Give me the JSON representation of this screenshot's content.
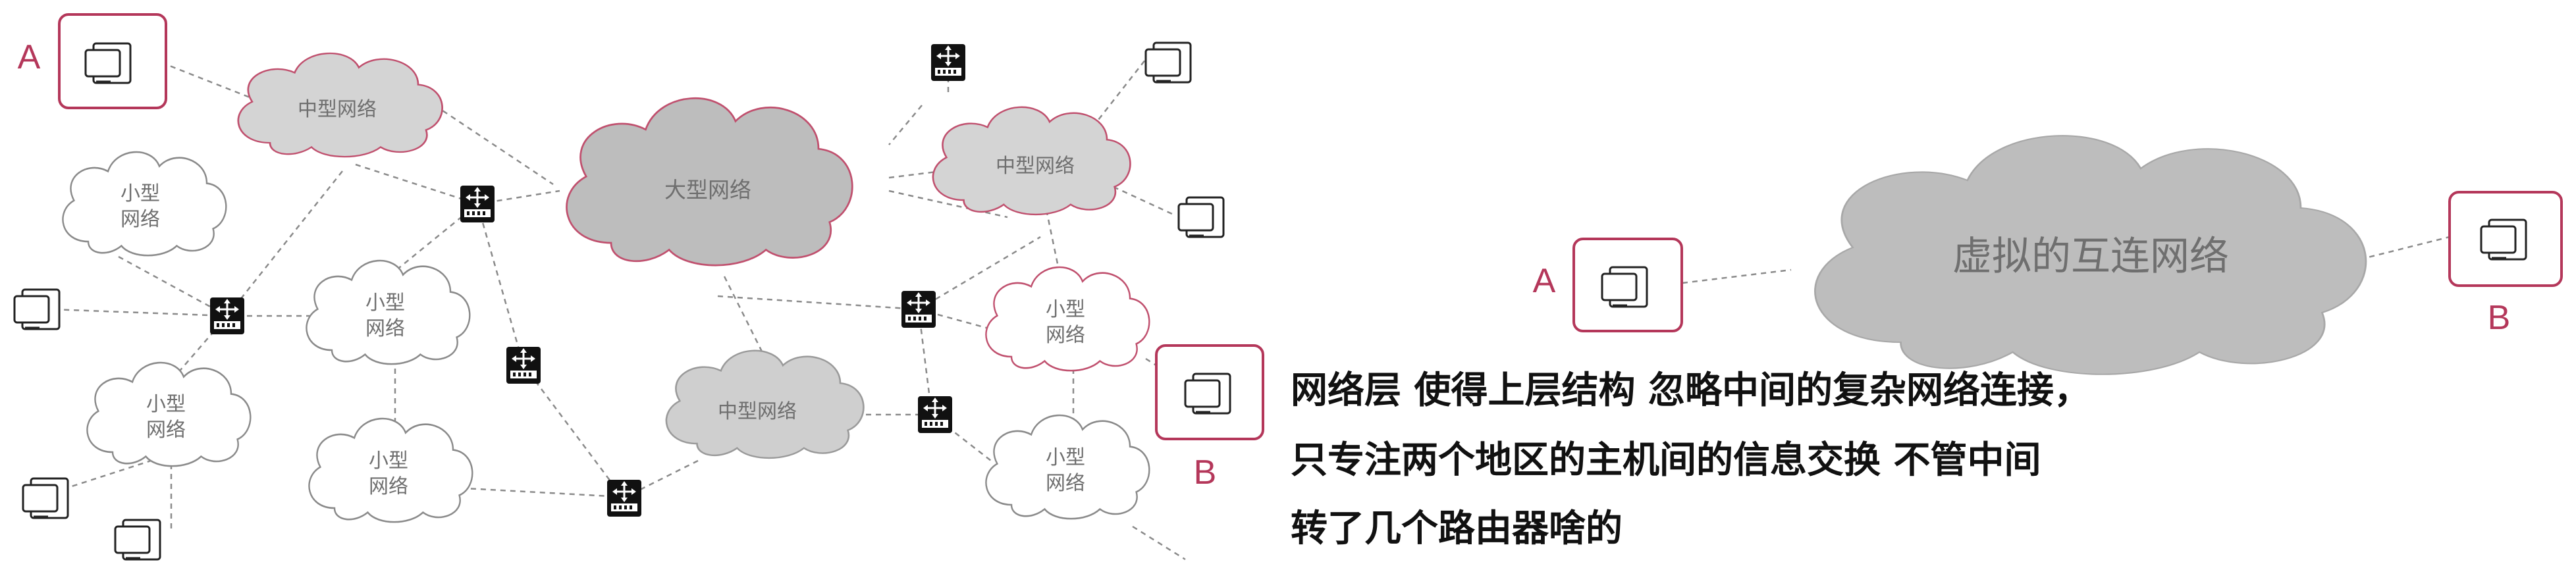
{
  "left_diagram": {
    "host_a_label": "A",
    "host_b_label": "B",
    "clouds": {
      "large": "大型网络",
      "medium_top_left": "中型网络",
      "medium_top_right": "中型网络",
      "medium_bottom": "中型网络",
      "small_1": "小型\n网络",
      "small_2": "小型\n网络",
      "small_3": "小型\n网络",
      "small_4": "小型\n网络",
      "small_5": "小型\n网络",
      "small_6": "小型\n网络"
    }
  },
  "right_diagram": {
    "cloud_label": "虚拟的互连网络",
    "host_a_label": "A",
    "host_b_label": "B"
  },
  "caption": {
    "line1": "网络层 使得上层结构 忽略中间的复杂网络连接，",
    "line2": "只专注两个地区的主机间的信息交换 不管中间",
    "line3": "转了几个路由器啥的"
  },
  "colors": {
    "accent": "#b4375a",
    "cloud_dark": "#bdbdbd",
    "cloud_light": "#ffffff",
    "cloud_medium": "#d4d4d4",
    "dashed_line": "#8a8a8a"
  },
  "icons": [
    "computer-icon",
    "router-icon"
  ]
}
